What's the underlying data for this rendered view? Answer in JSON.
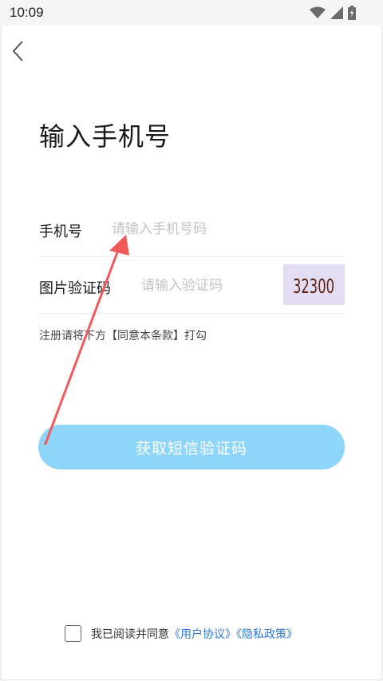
{
  "status_bar": {
    "time": "10:09",
    "icons": [
      "wifi-icon",
      "signal-icon",
      "battery-icon"
    ]
  },
  "header": {
    "back_icon": "chevron-left-icon",
    "title": "输入手机号"
  },
  "form": {
    "phone": {
      "label": "手机号",
      "placeholder": "请输入手机号码",
      "value": ""
    },
    "image_code": {
      "label": "图片验证码",
      "placeholder": "请输入验证码",
      "value": "",
      "captcha_text": "32300"
    },
    "hint": "注册请将下方【同意本条款】打勾"
  },
  "sms_button": {
    "label": "获取短信验证码"
  },
  "agreement": {
    "checked": false,
    "prefix": "我已阅读并同意",
    "user_agreement": "《用户协议》",
    "privacy_policy": "《隐私政策》"
  },
  "colors": {
    "button_bg": "#8ed5fa",
    "link": "#2f7bd6",
    "captcha_bg": "#e2ddf2",
    "captcha_text": "#5c2412",
    "annotation_arrow": "#f05a5a"
  }
}
